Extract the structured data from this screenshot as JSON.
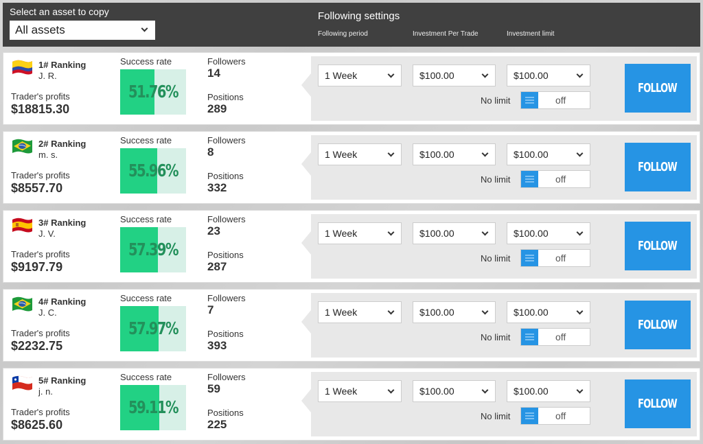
{
  "header": {
    "asset_label": "Select an asset to copy",
    "asset_select": "All assets",
    "settings_title": "Following settings",
    "col_period": "Following period",
    "col_invest": "Investment Per Trade",
    "col_limit": "Investment limit"
  },
  "labels": {
    "success_rate": "Success rate",
    "followers": "Followers",
    "positions": "Positions",
    "profits": "Trader's profits",
    "no_limit": "No limit",
    "toggle_off": "off",
    "follow": "FOLLOW"
  },
  "traders": [
    {
      "rank": "1# Ranking",
      "name": "J. R.",
      "flag": "colombia-flag",
      "profit": "$18815.30",
      "success_rate": "51.76%",
      "success_fraction": 0.5176,
      "followers": "14",
      "positions": "289",
      "period": "1 Week",
      "invest": "$100.00",
      "limit": "$100.00",
      "no_limit": "off"
    },
    {
      "rank": "2# Ranking",
      "name": "m. s.",
      "flag": "brazil-flag",
      "profit": "$8557.70",
      "success_rate": "55.96%",
      "success_fraction": 0.5596,
      "followers": "8",
      "positions": "332",
      "period": "1 Week",
      "invest": "$100.00",
      "limit": "$100.00",
      "no_limit": "off"
    },
    {
      "rank": "3# Ranking",
      "name": "J. V.",
      "flag": "spain-flag",
      "profit": "$9197.79",
      "success_rate": "57.39%",
      "success_fraction": 0.5739,
      "followers": "23",
      "positions": "287",
      "period": "1 Week",
      "invest": "$100.00",
      "limit": "$100.00",
      "no_limit": "off"
    },
    {
      "rank": "4# Ranking",
      "name": "J. C.",
      "flag": "brazil-flag",
      "profit": "$2232.75",
      "success_rate": "57.97%",
      "success_fraction": 0.5797,
      "followers": "7",
      "positions": "393",
      "period": "1 Week",
      "invest": "$100.00",
      "limit": "$100.00",
      "no_limit": "off"
    },
    {
      "rank": "5# Ranking",
      "name": "j. n.",
      "flag": "chile-flag",
      "profit": "$8625.60",
      "success_rate": "59.11%",
      "success_fraction": 0.5911,
      "followers": "59",
      "positions": "225",
      "period": "1 Week",
      "invest": "$100.00",
      "limit": "$100.00",
      "no_limit": "off"
    }
  ],
  "colors": {
    "accent_blue": "#2694e4",
    "success_green": "#22d184",
    "success_track": "#d7f0e7",
    "success_text": "#23905b",
    "header_bg": "#404040"
  }
}
